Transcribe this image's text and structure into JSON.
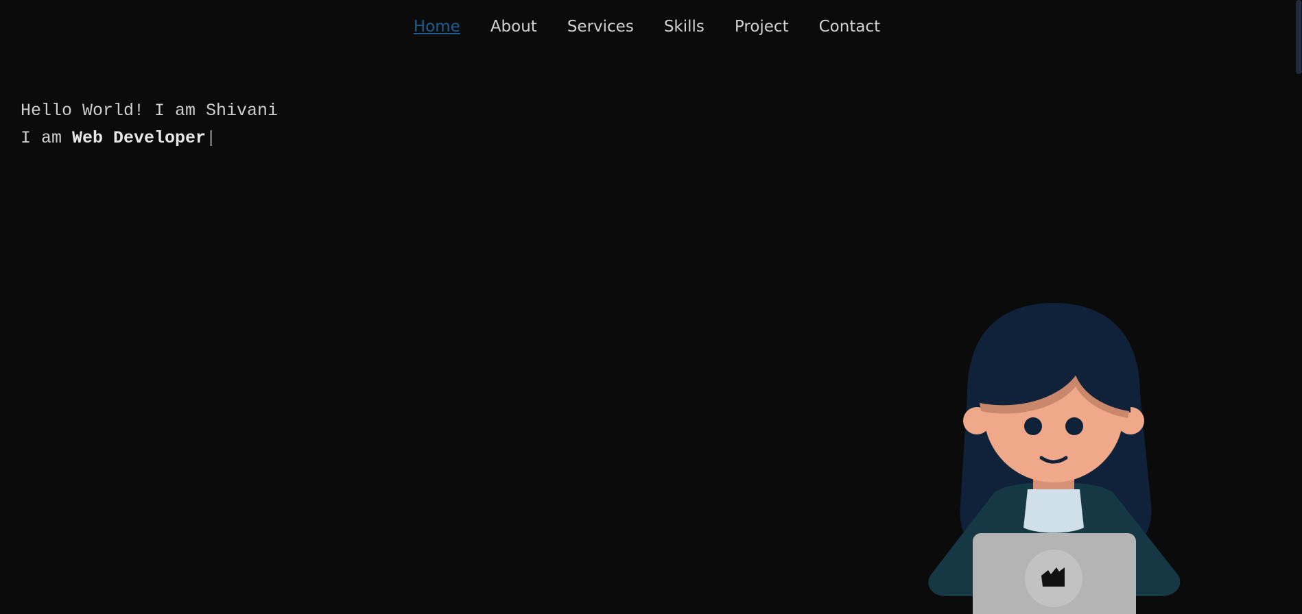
{
  "nav": {
    "items": [
      {
        "label": "Home",
        "active": true
      },
      {
        "label": "About",
        "active": false
      },
      {
        "label": "Services",
        "active": false
      },
      {
        "label": "Skills",
        "active": false
      },
      {
        "label": "Project",
        "active": false
      },
      {
        "label": "Contact",
        "active": false
      }
    ]
  },
  "hero": {
    "greeting": "Hello World! I am Shivani",
    "role_prefix": "I am ",
    "role": "Web Developer",
    "cursor": "|"
  },
  "illustration": {
    "icon": "developer-girl-with-laptop-illustration",
    "colors": {
      "hair": "#0f2239",
      "skin": "#efa98a",
      "jacket": "#163845",
      "collar": "#cfe0ea",
      "laptop": "#b4b4b4",
      "laptop_logo_bg": "#c7c7c7"
    }
  },
  "theme": {
    "background": "#0b0b0b",
    "nav_text": "#d2d2d2",
    "nav_active": "#1e5f91",
    "hero_text": "#cfcfcf"
  }
}
